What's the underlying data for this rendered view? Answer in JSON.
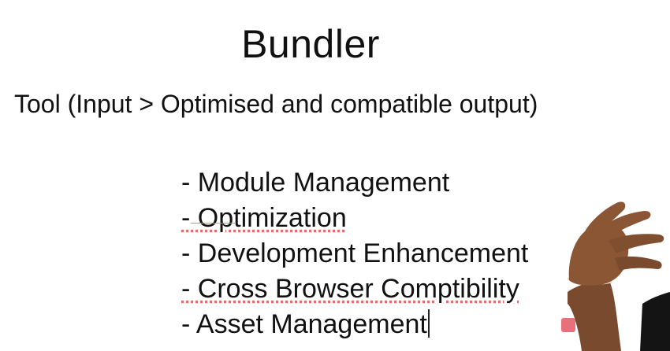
{
  "slide": {
    "title": "Bundler",
    "subtitle": "Tool (Input > Optimised and compatible output)",
    "bullets": [
      "- Module Management",
      "- Optimization",
      "- Development Enhancement",
      "- Cross Browser Comptibility",
      "- Asset Management"
    ]
  },
  "colors": {
    "background": "#ffffff",
    "text": "#111111",
    "spellcheck_underline": "#e07070",
    "record_indicator": "#e8707a",
    "skin": "#7a4a2e"
  },
  "icons": {
    "record_indicator": "record-indicator-icon",
    "presenter": "presenter-hand-image"
  }
}
